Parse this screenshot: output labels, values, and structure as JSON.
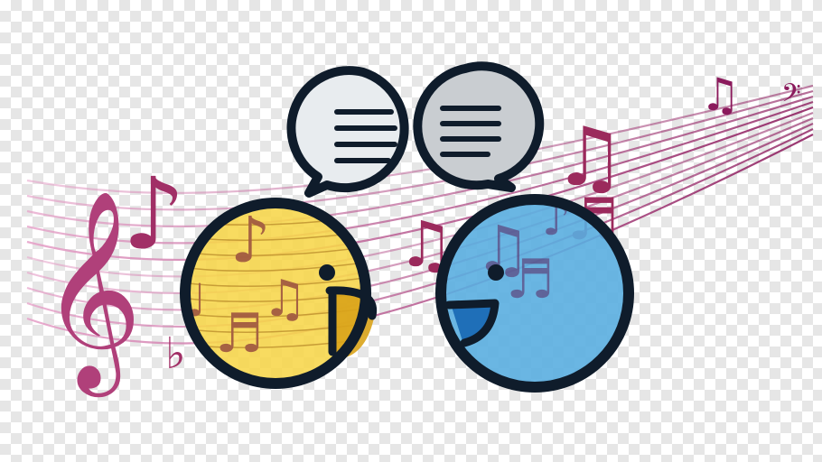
{
  "image": {
    "description_tags": [
      "music-staff",
      "chat-bubbles",
      "two-faces"
    ],
    "colors": {
      "staff_start": "#e6a0c8",
      "staff_end": "#8b1a5c",
      "note_color": "#9b2a5c",
      "outline": "#0f1c2b",
      "left_face": "#f7d64a",
      "right_face": "#5aaee0",
      "right_face_mouth": "#1f6fb8",
      "left_face_mouth": "#d9a31a",
      "bubble_left": "#e8ecef",
      "bubble_right": "#c9cdd1"
    }
  }
}
